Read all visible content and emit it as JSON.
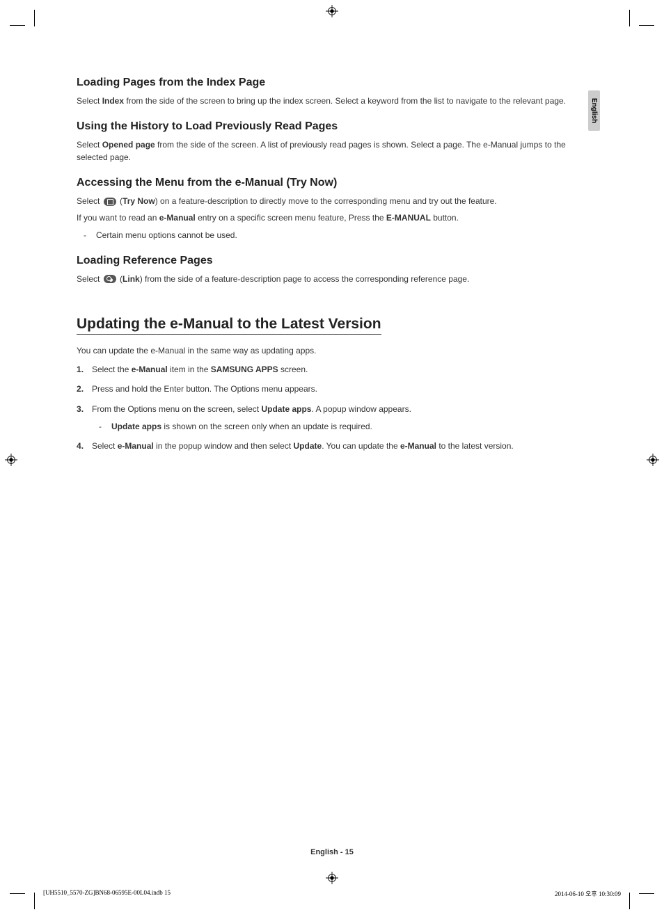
{
  "lang_tab": "English",
  "sec1": {
    "title": "Loading Pages from the Index Page",
    "p1a": "Select ",
    "p1b": "Index",
    "p1c": " from the side of the screen to bring up the index screen. Select a keyword from the list to navigate to the relevant page."
  },
  "sec2": {
    "title": "Using the History to Load Previously Read Pages",
    "p1a": "Select ",
    "p1b": "Opened page",
    "p1c": " from the side of the screen. A list of previously read pages is shown. Select a page. The e-Manual jumps to the selected page."
  },
  "sec3": {
    "title": "Accessing the Menu from the e-Manual (Try Now)",
    "p1a": "Select ",
    "p1b": "Try Now",
    "p1c": ") on a feature-description to directly move to the corresponding menu and try out the feature.",
    "p2a": "If you want to read an ",
    "p2b": "e-Manual",
    "p2c": " entry on a specific screen menu feature, Press the ",
    "p2d": "E-MANUAL",
    "p2e": " button.",
    "bullet": "Certain menu options cannot be used."
  },
  "sec4": {
    "title": "Loading Reference Pages",
    "p1a": "Select ",
    "p1b": "Link",
    "p1c": ") from the side of a feature-description page to access the corresponding reference page."
  },
  "sec5": {
    "title": "Updating the e-Manual to the Latest Version",
    "intro": "You can update the e-Manual in the same way as updating apps.",
    "s1a": "Select the ",
    "s1b": "e-Manual",
    "s1c": " item in the ",
    "s1d": "SAMSUNG APPS",
    "s1e": " screen.",
    "s2": "Press and hold the Enter button. The Options menu appears.",
    "s3a": "From the Options menu on the screen, select ",
    "s3b": "Update apps",
    "s3c": ". A popup window appears.",
    "s3_sub_a": "Update apps",
    "s3_sub_b": " is shown on the screen only when an update is required.",
    "s4a": "Select ",
    "s4b": "e-Manual",
    "s4c": " in the popup window and then select ",
    "s4d": "Update",
    "s4e": ". You can update the ",
    "s4f": "e-Manual",
    "s4g": " to the latest version."
  },
  "footer_page": "English - 15",
  "footer_left": "[UH5510_5570-ZG]BN68-06595E-00L04.indb   15",
  "footer_right": "2014-06-10   오후 10:30:09"
}
